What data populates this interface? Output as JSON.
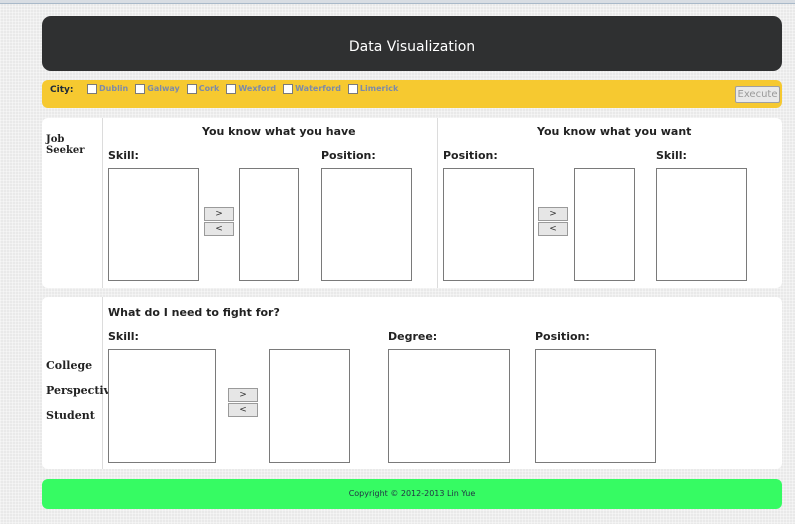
{
  "header": {
    "title": "Data Visualization"
  },
  "city_filter": {
    "label": "City:",
    "options": [
      {
        "name": "Dublin",
        "checked": false
      },
      {
        "name": "Galway",
        "checked": false
      },
      {
        "name": "Cork",
        "checked": false
      },
      {
        "name": "Wexford",
        "checked": false
      },
      {
        "name": "Waterford",
        "checked": false
      },
      {
        "name": "Limerick",
        "checked": false
      }
    ],
    "execute_label": "Execute"
  },
  "job_seeker": {
    "label_line1": "Job",
    "label_line2": "Seeker",
    "have": {
      "title": "You know what you have",
      "skill_label": "Skill:",
      "position_label": "Position:"
    },
    "want": {
      "title": "You know what you want",
      "position_label": "Position:",
      "skill_label": "Skill:"
    },
    "add_label": ">",
    "remove_label": "<"
  },
  "college": {
    "labels": [
      "College",
      "Perspective",
      "Student"
    ],
    "title": "What do I need to fight for?",
    "skill_label": "Skill:",
    "degree_label": "Degree:",
    "position_label": "Position:",
    "add_label": ">",
    "remove_label": "<"
  },
  "footer": {
    "copyright": "Copyright © 2012-2013 Lin Yue"
  },
  "colors": {
    "header_bg": "#2f3031",
    "city_bar_bg": "#f6c930",
    "footer_bg": "#36fb63",
    "city_text": "#7d8aa8"
  }
}
